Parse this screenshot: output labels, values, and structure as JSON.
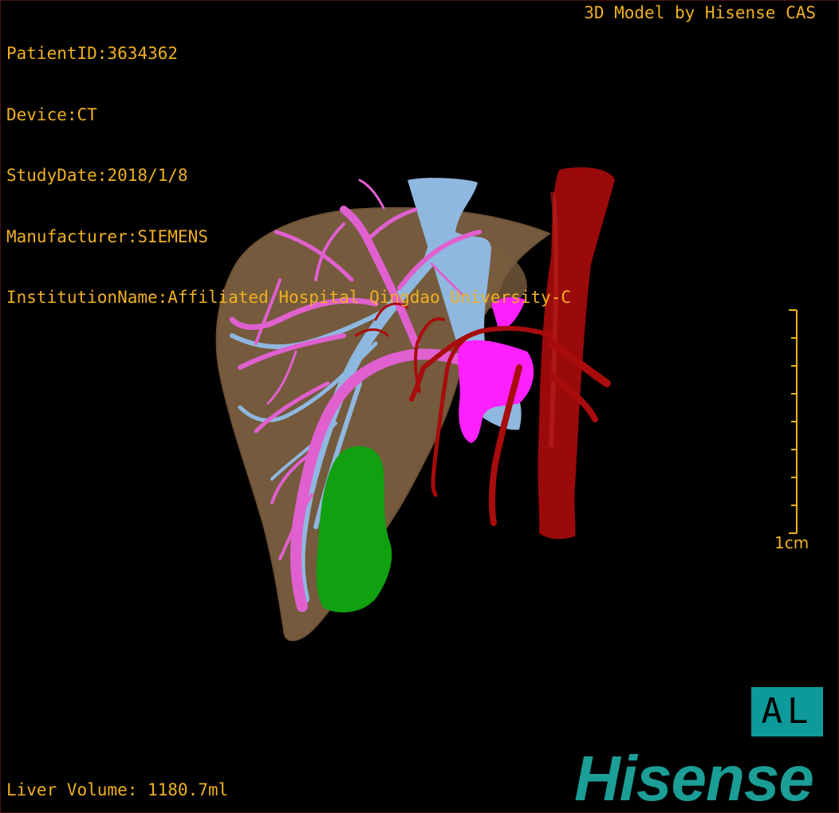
{
  "header": {
    "patient_id": "PatientID:3634362",
    "device": "Device:CT",
    "study_date": "StudyDate:2018/1/8",
    "manufacturer": "Manufacturer:SIEMENS",
    "institution": "InstitutionName:Affiliated Hospital Qingdao University-C"
  },
  "credit": "3D Model by Hisense CAS",
  "footer": {
    "liver_volume": "Liver Volume: 1180.7ml"
  },
  "scale_bar": {
    "label": "1cm",
    "color": "#f0b020"
  },
  "orientation": {
    "label": "AL",
    "color": "#0f9a9a"
  },
  "brand": {
    "logo_text": "Hisense",
    "color": "#1a9e96"
  },
  "model_colors": {
    "liver": "#8a6a48",
    "portal_vein": "#e060d0",
    "hepatic_vein": "#8fb8e0",
    "aorta": "#9a0a0a",
    "arteries": "#a80c0c",
    "gallbladder": "#10a010",
    "portal_trunk": "#ff20ff"
  }
}
